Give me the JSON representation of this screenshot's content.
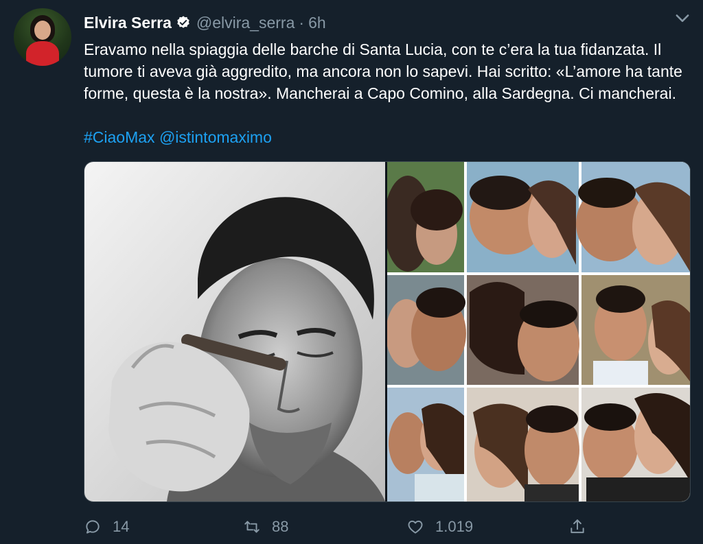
{
  "tweet": {
    "author_name": "Elvira Serra",
    "handle": "@elvira_serra",
    "separator": "·",
    "time": "6h",
    "text": "Eravamo nella spiaggia delle barche di Santa Lucia, con te c’era la tua fidanzata. Il tumore ti aveva già aggredito, ma ancora non lo sapevi. Hai scritto: «L’amore ha tante forme, questa è la nostra». Mancherai a Capo Comino, alla Sardegna. Ci mancherai.",
    "hashtag": "#CiaoMax",
    "mention": "@istintomaximo"
  },
  "actions": {
    "reply_count": "14",
    "retweet_count": "88",
    "like_count": "1.019"
  },
  "icons": {
    "verified": "verified-badge-icon",
    "more": "chevron-down-icon",
    "reply": "reply-icon",
    "retweet": "retweet-icon",
    "like": "heart-icon",
    "share": "share-icon"
  },
  "colors": {
    "background": "#15202b",
    "text": "#ffffff",
    "muted": "#8899a6",
    "link": "#1da1f2",
    "border": "#38444d"
  }
}
